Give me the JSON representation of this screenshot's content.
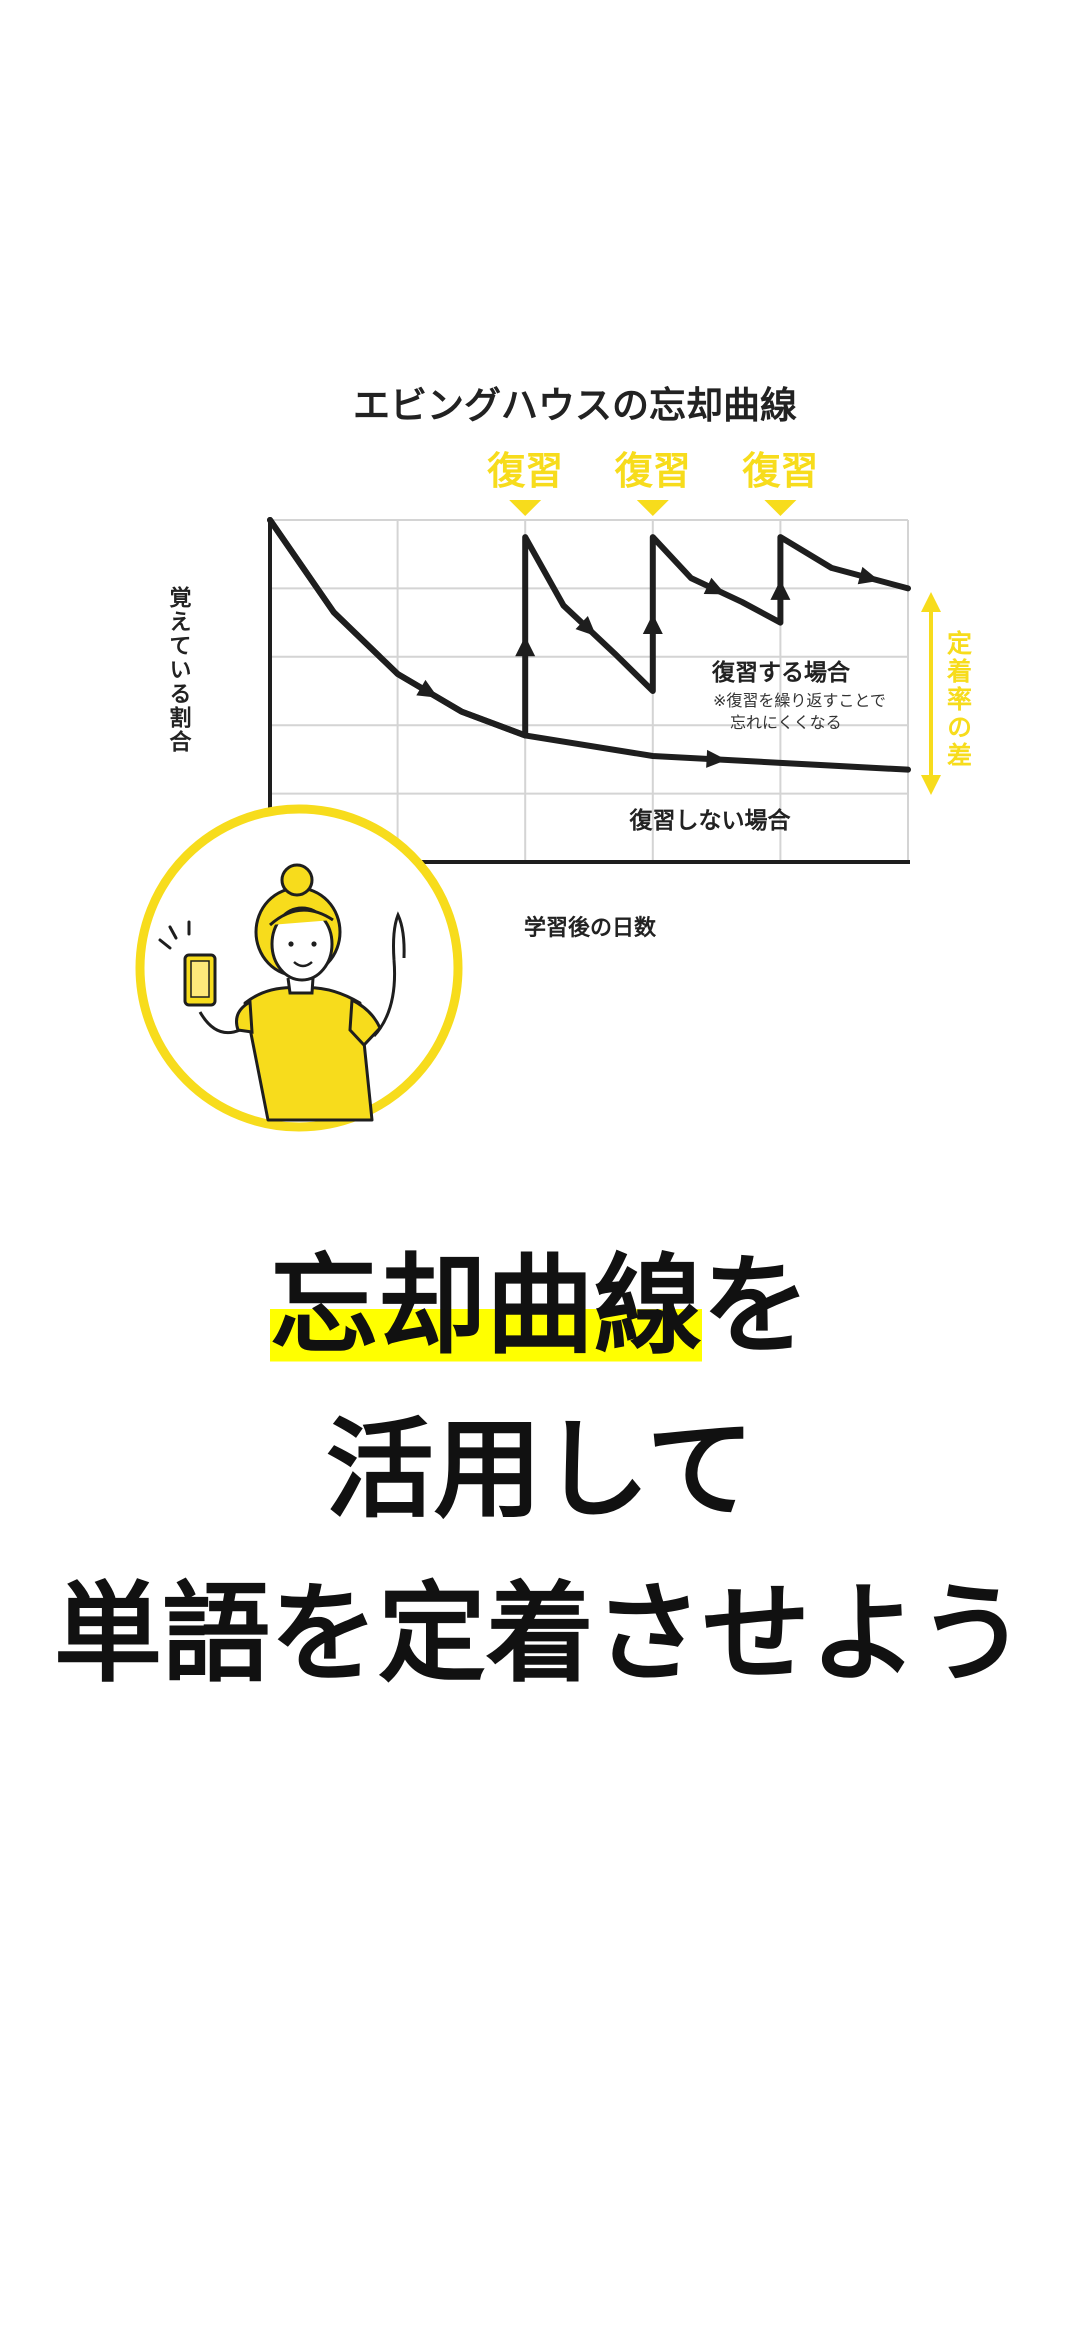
{
  "colors": {
    "accent_yellow": "#f7dc1c",
    "marker_yellow": "#ffff00",
    "line_dark": "#1e1e1e",
    "grid": "#d4d4d4",
    "text": "#111111"
  },
  "chart_data": {
    "type": "line",
    "title": "エビングハウスの忘却曲線",
    "xlabel": "学習後の日数",
    "ylabel": "覚えている割合",
    "grid": true,
    "review_markers": [
      "復習",
      "復習",
      "復習"
    ],
    "series": [
      {
        "name": "復習しない場合",
        "x": [
          0,
          0.5,
          1,
          1.5,
          2,
          3,
          4,
          5
        ],
        "y": [
          100,
          73,
          55,
          44,
          37,
          31,
          29,
          27
        ]
      },
      {
        "name": "復習する場合",
        "x": [
          0,
          0.5,
          1,
          1.5,
          2,
          2,
          2.3,
          2.7,
          3,
          3,
          3.3,
          3.7,
          4,
          4,
          4.4,
          5
        ],
        "y": [
          100,
          73,
          55,
          44,
          37,
          95,
          75,
          61,
          50,
          95,
          83,
          76,
          70,
          95,
          86,
          80
        ]
      }
    ],
    "annotations": {
      "review_case_label": "復習する場合",
      "review_case_note_line1": "※復習を繰り返すことで",
      "review_case_note_line2": "忘れにくくなる",
      "retention_gap_label": "定着率の差"
    }
  },
  "headline": {
    "line1_highlight": "忘却曲線",
    "line1_rest": "を",
    "line2": "活用して",
    "line3": "単語を定着させよう"
  }
}
